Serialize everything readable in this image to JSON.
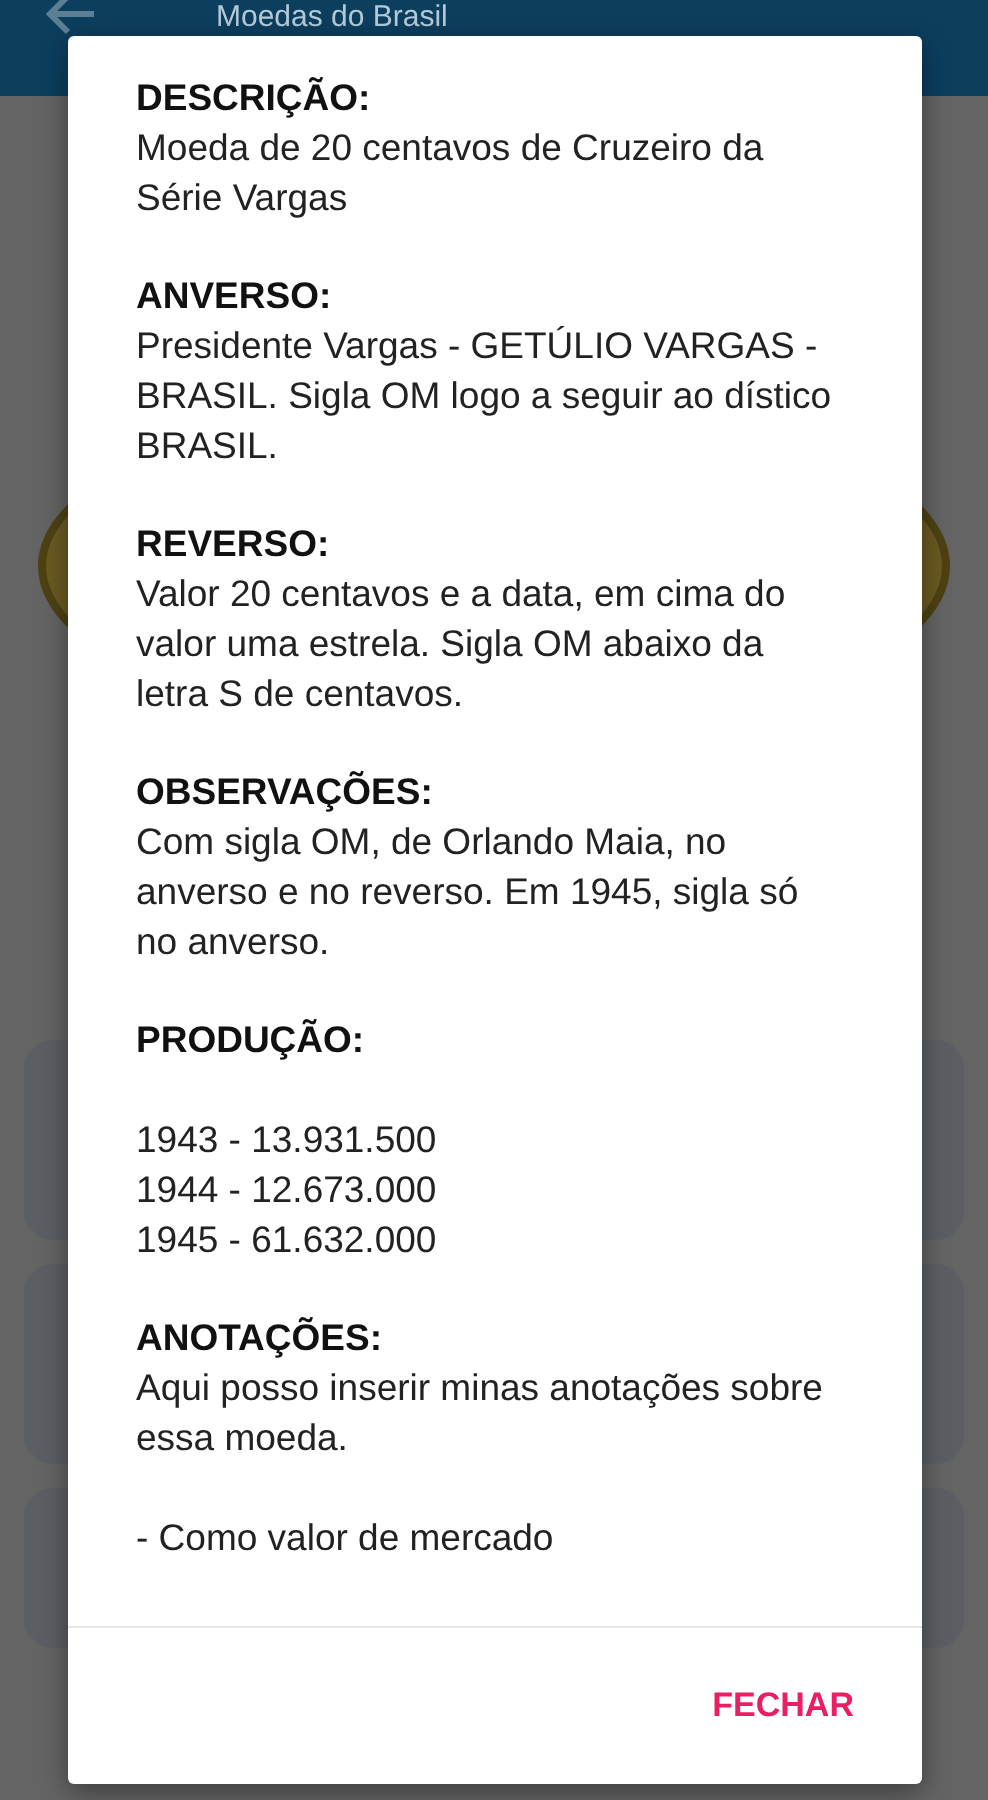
{
  "app_bar": {
    "title": "Moedas do Brasil"
  },
  "dialog": {
    "sections": [
      {
        "heading": "DESCRIÇÃO:",
        "kind": "text",
        "paragraphs": [
          "Moeda de 20 centavos de Cruzeiro da Série Vargas"
        ]
      },
      {
        "heading": "ANVERSO:",
        "kind": "text",
        "paragraphs": [
          "Presidente Vargas - GETÚLIO VARGAS - BRASIL. Sigla OM logo a seguir ao dístico BRASIL."
        ]
      },
      {
        "heading": "REVERSO:",
        "kind": "text",
        "paragraphs": [
          "Valor 20 centavos e a data, em cima do valor uma estrela. Sigla OM abaixo da letra S de centavos."
        ]
      },
      {
        "heading": "OBSERVAÇÕES:",
        "kind": "text",
        "paragraphs": [
          "Com sigla OM, de Orlando Maia, no anverso e no reverso. Em 1945, sigla só no anverso."
        ]
      },
      {
        "heading": "PRODUÇÃO:",
        "kind": "list",
        "paragraphs": [
          "1943 - 13.931.500",
          "1944 - 12.673.000",
          "1945 - 61.632.000"
        ]
      },
      {
        "heading": "ANOTAÇÕES:",
        "kind": "text",
        "paragraphs": [
          "Aqui posso inserir minas anotações sobre essa moeda.",
          "- Como valor de mercado"
        ]
      }
    ],
    "button": "FECHAR"
  }
}
